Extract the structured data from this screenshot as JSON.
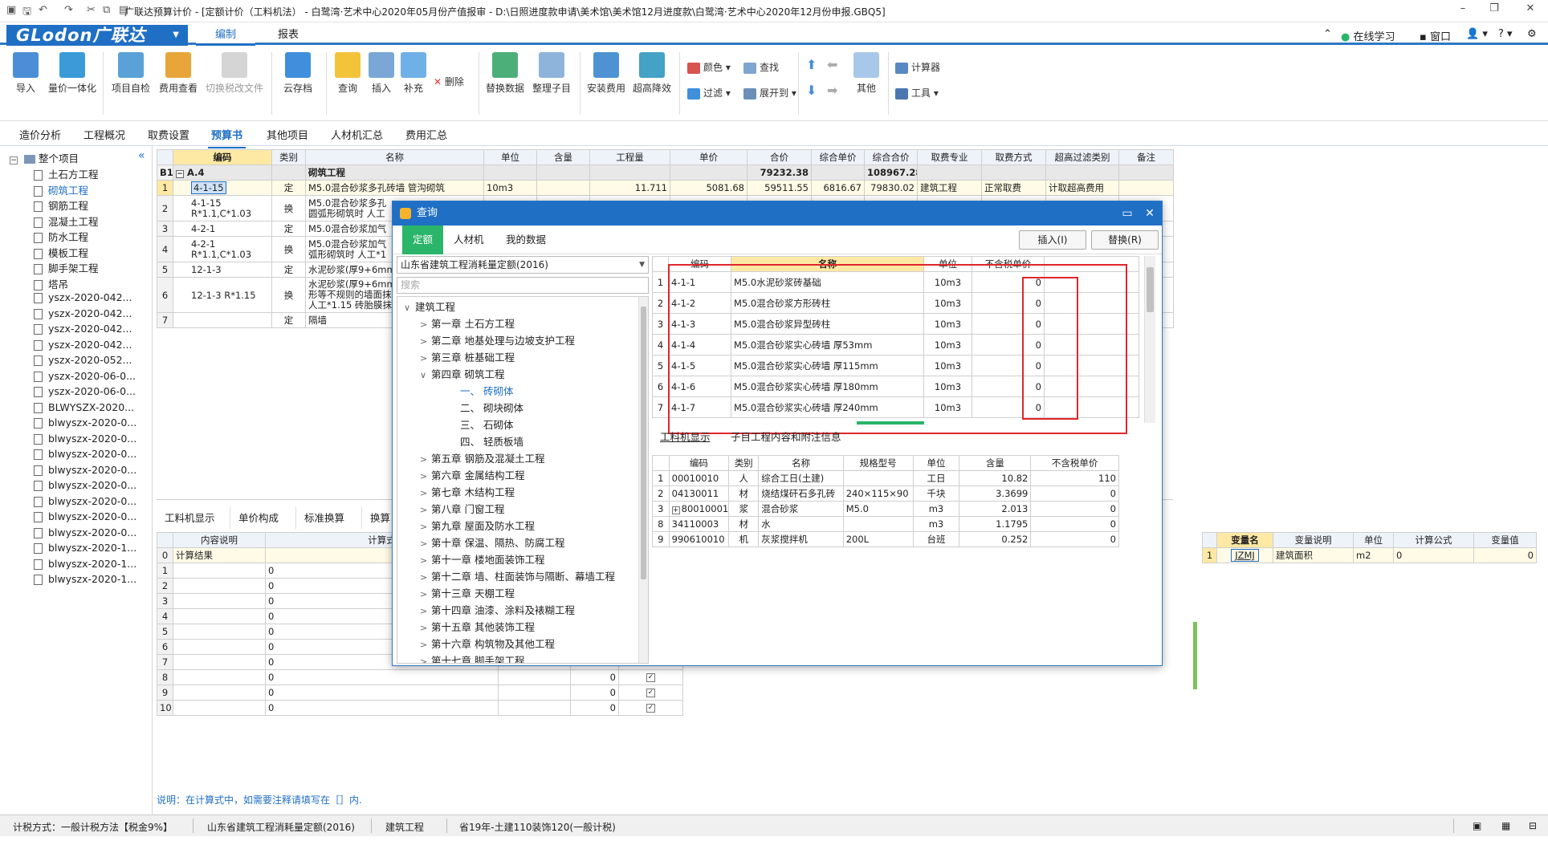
{
  "titlebar": {
    "title": "广联达预算计价 - [定额计价（工料机法） - 白鹭湾·艺术中心2020年05月份产值报审 - D:\\日照进度款申请\\美术馆\\美术馆12月进度款\\白鹭湾·艺术中心2020年12月份申报.GBQ5]"
  },
  "menu": {
    "logo": "GLodon广联达",
    "tabs": [
      "编制",
      "报表"
    ],
    "online": "在线学习",
    "window": "窗口"
  },
  "ribbon": {
    "big": [
      "导入",
      "量价一体化",
      "项目自检",
      "费用查看",
      "切换税改文件",
      "云存档",
      "查询",
      "插入",
      "补充",
      "替换数据",
      "整理子目",
      "安装费用",
      "超高降效",
      "其他"
    ],
    "small": [
      "删除",
      "颜色",
      "查找",
      "过滤",
      "展开到",
      "计算器",
      "工具"
    ]
  },
  "tabs2": [
    "造价分析",
    "工程概况",
    "取费设置",
    "预算书",
    "其他项目",
    "人材机汇总",
    "费用汇总"
  ],
  "tree": {
    "root": "整个项目",
    "items": [
      "土石方工程",
      "砌筑工程",
      "钢筋工程",
      "混凝土工程",
      "防水工程",
      "模板工程",
      "脚手架工程",
      "塔吊",
      "yszx-2020-042...",
      "yszx-2020-042...",
      "yszx-2020-042...",
      "yszx-2020-042...",
      "yszx-2020-052...",
      "yszx-2020-06-0...",
      "yszx-2020-06-0...",
      "BLWYSZX-2020...",
      "blwyszx-2020-0...",
      "blwyszx-2020-0...",
      "blwyszx-2020-0...",
      "blwyszx-2020-0...",
      "blwyszx-2020-0...",
      "blwyszx-2020-0...",
      "blwyszx-2020-0...",
      "blwyszx-2020-0...",
      "blwyszx-2020-1...",
      "blwyszx-2020-1...",
      "blwyszx-2020-1..."
    ]
  },
  "main": {
    "headers": [
      "编码",
      "类别",
      "名称",
      "单位",
      "含量",
      "工程量",
      "单价",
      "合价",
      "综合单价",
      "综合合价",
      "取费专业",
      "取费方式",
      "超高过滤类别",
      "备注"
    ],
    "sec": {
      "no": "B1",
      "code": "A.4",
      "name": "砌筑工程",
      "hj": "79232.38",
      "zhhj": "108967.28"
    },
    "rows": [
      {
        "no": "1",
        "code": "4-1-15",
        "lb": "定",
        "name": "M5.0混合砂浆多孔砖墙 管沟砌筑",
        "unit": "10m3",
        "gcl": "11.711",
        "dj": "5081.68",
        "hj": "59511.55",
        "zhdj": "6816.67",
        "zhhj": "79830.02",
        "qfzy": "建筑工程",
        "qffs": "正常取费",
        "cg": "计取超高费用"
      },
      {
        "no": "2",
        "code": "4-1-15",
        "code2": "R*1.1,C*1.03",
        "lb": "换",
        "name": "M5.0混合砂浆多孔",
        "name2": "圆弧形砌筑时 人工"
      },
      {
        "no": "3",
        "code": "4-2-1",
        "lb": "定",
        "name": "M5.0混合砂浆加气"
      },
      {
        "no": "4",
        "code": "4-2-1",
        "code2": "R*1.1,C*1.03",
        "lb": "换",
        "name": "M5.0混合砂浆加气",
        "name2": "弧形砌筑时 人工*1"
      },
      {
        "no": "5",
        "code": "12-1-3",
        "lb": "定",
        "name": "水泥砂浆(厚9+6mm)"
      },
      {
        "no": "6",
        "code": "12-1-3 R*1.15",
        "lb": "换",
        "name": "水泥砂浆(厚9+6mm)",
        "name2": "形等不规则的墙面抹",
        "name3": "人工*1.15 砖胎膜抹"
      },
      {
        "no": "7",
        "code": "",
        "lb": "定",
        "name": "隔墙"
      }
    ]
  },
  "lower": {
    "tabs": [
      "工料机显示",
      "单价构成",
      "标准换算",
      "换算"
    ],
    "h1": "内容说明",
    "h2": "计算式",
    "r0": "计算结果",
    "rows": [
      "1",
      "2",
      "3",
      "4",
      "5",
      "6",
      "7",
      "8",
      "9",
      "10"
    ],
    "zero": "0"
  },
  "varpanel": {
    "headers": [
      "变量名",
      "变量说明",
      "单位",
      "计算公式",
      "变量值"
    ],
    "row": {
      "no": "1",
      "name": "JZMJ",
      "desc": "建筑面积",
      "unit": "m2",
      "formula": "0",
      "value": "0"
    }
  },
  "note": "说明：在计算式中，如需要注释请填写在［］内.",
  "statusbar": [
    "计税方式：一般计税方法【税金9%】",
    "山东省建筑工程消耗量定额(2016)",
    "建筑工程",
    "省19年-土建110装饰120(一般计税)"
  ],
  "dialog": {
    "title": "查询",
    "tabs": [
      "定额",
      "人材机",
      "我的数据"
    ],
    "insert": "插入(I)",
    "replace": "替换(R)",
    "library": "山东省建筑工程消耗量定额(2016)",
    "search": "搜索",
    "tree": [
      {
        "t": "建筑工程",
        "lvl": 0,
        "c": "∨"
      },
      {
        "t": "第一章  土石方工程",
        "lvl": 1,
        "c": ">"
      },
      {
        "t": "第二章  地基处理与边坡支护工程",
        "lvl": 1,
        "c": ">"
      },
      {
        "t": "第三章  桩基础工程",
        "lvl": 1,
        "c": ">"
      },
      {
        "t": "第四章  砌筑工程",
        "lvl": 1,
        "c": "∨"
      },
      {
        "t": "一、  砖砌体",
        "lvl": 2,
        "c": "",
        "sel": true
      },
      {
        "t": "二、  砌块砌体",
        "lvl": 2,
        "c": ""
      },
      {
        "t": "三、  石砌体",
        "lvl": 2,
        "c": ""
      },
      {
        "t": "四、  轻质板墙",
        "lvl": 2,
        "c": ""
      },
      {
        "t": "第五章  钢筋及混凝土工程",
        "lvl": 1,
        "c": ">"
      },
      {
        "t": "第六章  金属结构工程",
        "lvl": 1,
        "c": ">"
      },
      {
        "t": "第七章  木结构工程",
        "lvl": 1,
        "c": ">"
      },
      {
        "t": "第八章  门窗工程",
        "lvl": 1,
        "c": ">"
      },
      {
        "t": "第九章  屋面及防水工程",
        "lvl": 1,
        "c": ">"
      },
      {
        "t": "第十章  保温、隔热、防腐工程",
        "lvl": 1,
        "c": ">"
      },
      {
        "t": "第十一章  楼地面装饰工程",
        "lvl": 1,
        "c": ">"
      },
      {
        "t": "第十二章  墙、柱面装饰与隔断、幕墙工程",
        "lvl": 1,
        "c": ">"
      },
      {
        "t": "第十三章  天棚工程",
        "lvl": 1,
        "c": ">"
      },
      {
        "t": "第十四章  油漆、涂料及裱糊工程",
        "lvl": 1,
        "c": ">"
      },
      {
        "t": "第十五章  其他装饰工程",
        "lvl": 1,
        "c": ">"
      },
      {
        "t": "第十六章  构筑物及其他工程",
        "lvl": 1,
        "c": ">"
      },
      {
        "t": "第十七章  脚手架工程",
        "lvl": 1,
        "c": ">"
      }
    ],
    "qheaders": [
      "编码",
      "名称",
      "单位",
      "不含税单价"
    ],
    "qrows": [
      {
        "no": "1",
        "code": "4-1-1",
        "name": "M5.0水泥砂浆砖基础",
        "unit": "10m3",
        "price": "0"
      },
      {
        "no": "2",
        "code": "4-1-2",
        "name": "M5.0混合砂浆方形砖柱",
        "unit": "10m3",
        "price": "0"
      },
      {
        "no": "3",
        "code": "4-1-3",
        "name": "M5.0混合砂浆异型砖柱",
        "unit": "10m3",
        "price": "0"
      },
      {
        "no": "4",
        "code": "4-1-4",
        "name": "M5.0混合砂浆实心砖墙 厚53mm",
        "unit": "10m3",
        "price": "0"
      },
      {
        "no": "5",
        "code": "4-1-5",
        "name": "M5.0混合砂浆实心砖墙 厚115mm",
        "unit": "10m3",
        "price": "0"
      },
      {
        "no": "6",
        "code": "4-1-6",
        "name": "M5.0混合砂浆实心砖墙 厚180mm",
        "unit": "10m3",
        "price": "0"
      },
      {
        "no": "7",
        "code": "4-1-7",
        "name": "M5.0混合砂浆实心砖墙 厚240mm",
        "unit": "10m3",
        "price": "0"
      }
    ],
    "subtabs": [
      "工料机显示",
      "子目工程内容和附注信息"
    ],
    "mheaders": [
      "编码",
      "类别",
      "名称",
      "规格型号",
      "单位",
      "含量",
      "不含税单价"
    ],
    "mrows": [
      {
        "no": "1",
        "code": "00010010",
        "lb": "人",
        "name": "综合工日(土建)",
        "spec": "",
        "unit": "工日",
        "qty": "10.82",
        "price": "110"
      },
      {
        "no": "2",
        "code": "04130011",
        "lb": "材",
        "name": "烧结煤矸石多孔砖",
        "spec": "240×115×90",
        "unit": "千块",
        "qty": "3.3699",
        "price": "0"
      },
      {
        "no": "3",
        "code": "80010001",
        "lb": "浆",
        "name": "混合砂浆",
        "spec": "M5.0",
        "unit": "m3",
        "qty": "2.013",
        "price": "0",
        "plus": "+"
      },
      {
        "no": "8",
        "code": "34110003",
        "lb": "材",
        "name": "水",
        "spec": "",
        "unit": "m3",
        "qty": "1.1795",
        "price": "0"
      },
      {
        "no": "9",
        "code": "990610010",
        "lb": "机",
        "name": "灰浆搅拌机",
        "spec": "200L",
        "unit": "台班",
        "qty": "0.252",
        "price": "0"
      }
    ]
  },
  "colors": {
    "brand": "#1f6fc5",
    "activeTab": "#2ab56a",
    "highlight": "#e0262b"
  }
}
